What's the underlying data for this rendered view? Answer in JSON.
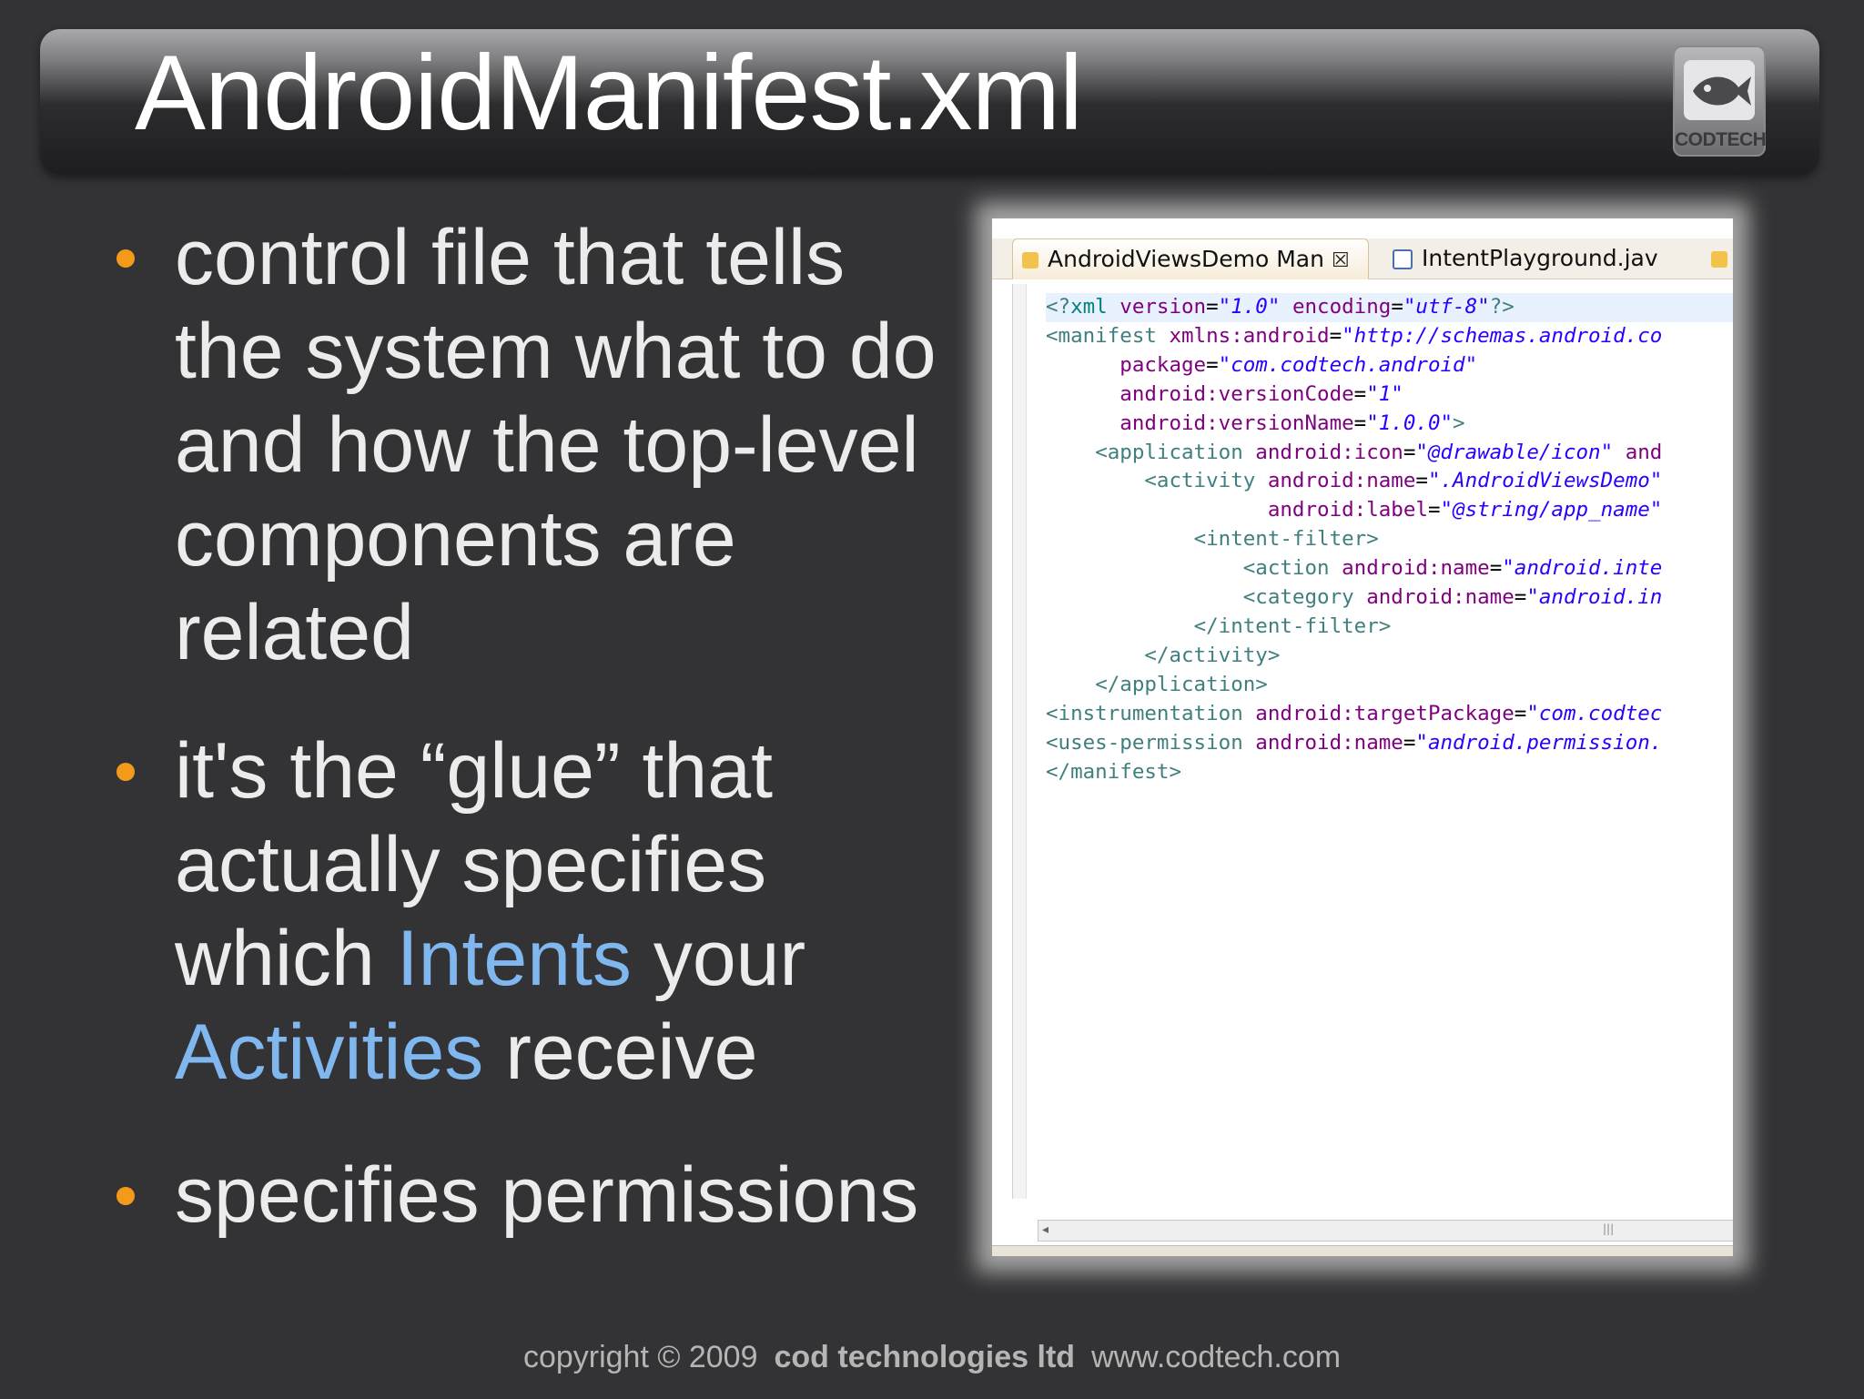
{
  "slide": {
    "title": "AndroidManifest.xml",
    "logo_text": "CODTECH"
  },
  "bullets": [
    {
      "text": "control file that tells the system what to do and how the top-level components are related"
    },
    {
      "parts": [
        "it's the “glue” that actually specifies which ",
        "Intents",
        " your ",
        "Activities",
        " receive"
      ]
    },
    {
      "text": "specifies permissions"
    }
  ],
  "editor": {
    "tabs": [
      {
        "label": "AndroidViewsDemo Man",
        "icon": "xml-file-icon",
        "active": true
      },
      {
        "label": "IntentPlayground.jav",
        "icon": "java-file-icon",
        "active": false
      }
    ],
    "code_lines": [
      "<?xml version=\"1.0\" encoding=\"utf-8\"?>",
      "<manifest xmlns:android=\"http://schemas.android.co",
      "      package=\"com.codtech.android\"",
      "      android:versionCode=\"1\"",
      "      android:versionName=\"1.0.0\">",
      "    <application android:icon=\"@drawable/icon\" and",
      "        <activity android:name=\".AndroidViewsDemo\"",
      "                  android:label=\"@string/app_name\"",
      "            <intent-filter>",
      "                <action android:name=\"android.inte",
      "                <category android:name=\"android.in",
      "            </intent-filter>",
      "        </activity>",
      "    </application>",
      "<instrumentation android:targetPackage=\"com.codtec",
      "<uses-permission android:name=\"android.permission.",
      "</manifest>"
    ]
  },
  "footer": {
    "copyright": "copyright © 2009",
    "company": "cod technologies ltd",
    "website": "www.codtech.com"
  },
  "colors": {
    "background": "#333335",
    "bullet": "#f39a1b",
    "highlight": "#7fb7ee",
    "xml_tag": "#3f7f7f",
    "xml_attr": "#7f007f",
    "xml_value": "#2a00ff"
  }
}
